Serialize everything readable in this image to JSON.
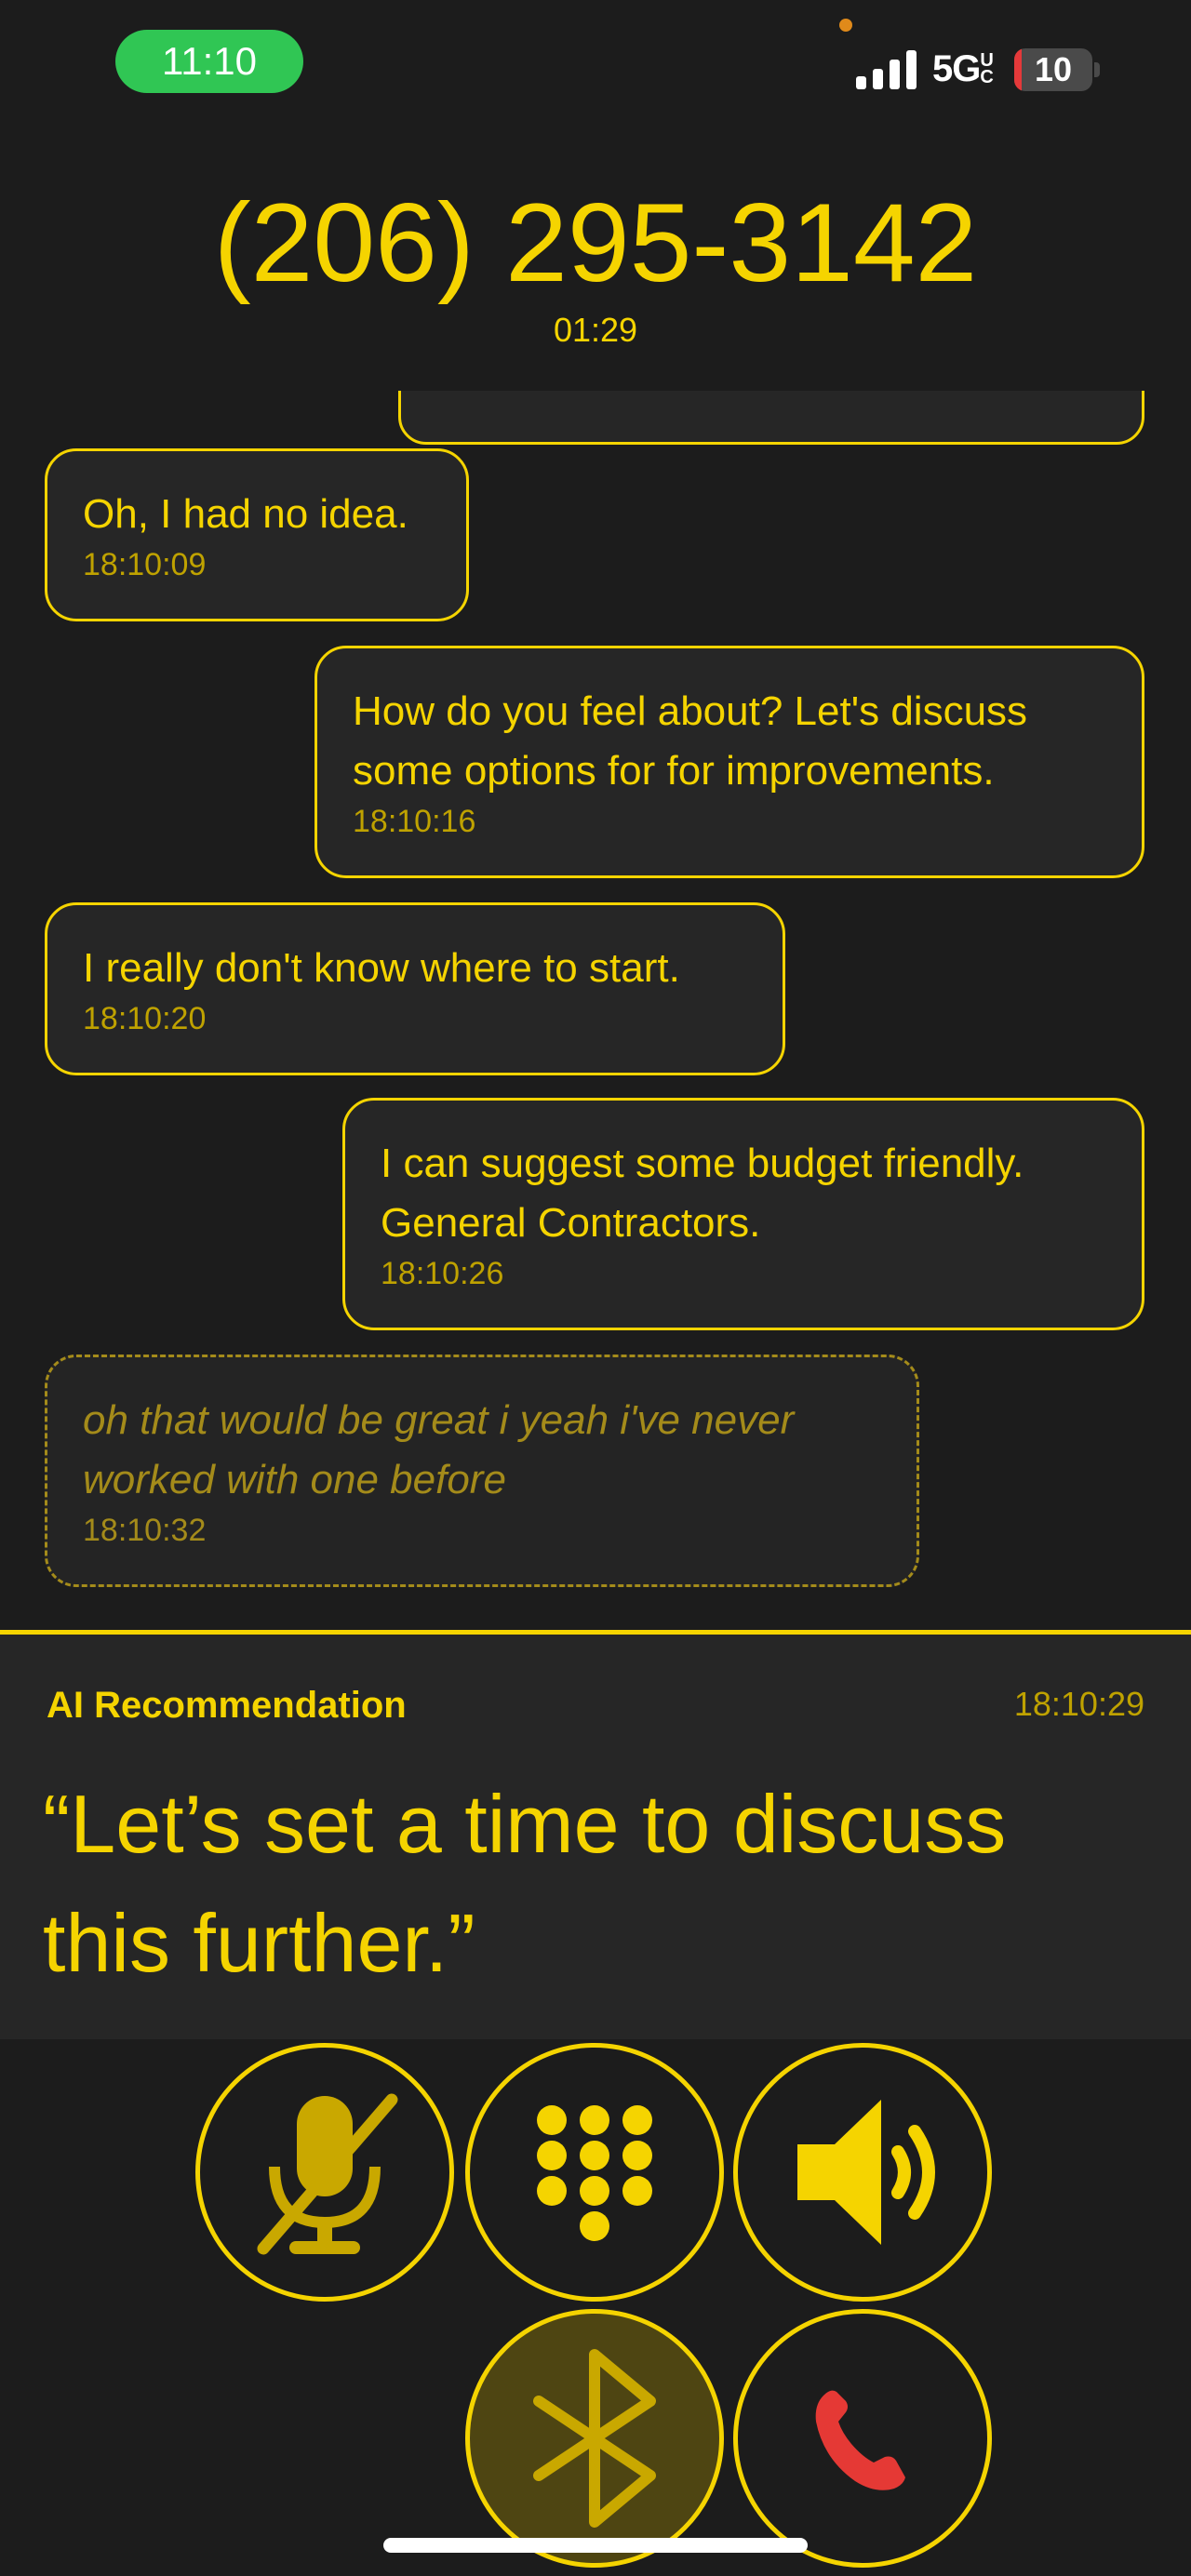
{
  "status_bar": {
    "time": "11:10",
    "network": "5G",
    "network_suffix": "UC",
    "battery_level": 10,
    "battery_label": "10"
  },
  "call": {
    "number": "(206) 295-3142",
    "duration": "01:29"
  },
  "transcript": [
    {
      "speaker": "caller",
      "text": "Oh, I had no idea.",
      "time": "18:10:09"
    },
    {
      "speaker": "user",
      "text": "How do you feel about? Let's discuss some options for for improvements.",
      "time": "18:10:16"
    },
    {
      "speaker": "caller",
      "text": "I really don't know where to start.",
      "time": "18:10:20"
    },
    {
      "speaker": "user",
      "text": "I can suggest some budget friendly. General Contractors.",
      "time": "18:10:26"
    },
    {
      "speaker": "caller",
      "text": "oh that would be great i yeah i've never worked with one before",
      "time": "18:10:32",
      "pending": true
    }
  ],
  "ai_recommendation": {
    "title": "AI Recommendation",
    "time": "18:10:29",
    "text": "“Let’s set a time to discuss this further.”"
  },
  "controls": [
    {
      "icon": "microphone-muted-icon",
      "state": "muted"
    },
    {
      "icon": "keypad-icon",
      "state": "normal"
    },
    {
      "icon": "speaker-icon",
      "state": "normal"
    },
    {
      "icon": "bluetooth-icon",
      "state": "active"
    },
    {
      "icon": "end-call-icon",
      "state": "normal"
    }
  ],
  "colors": {
    "background": "#1c1c1c",
    "accent": "#f5d400",
    "bubble": "#262626",
    "status_pill": "#30c654",
    "end_call": "#e53935"
  }
}
